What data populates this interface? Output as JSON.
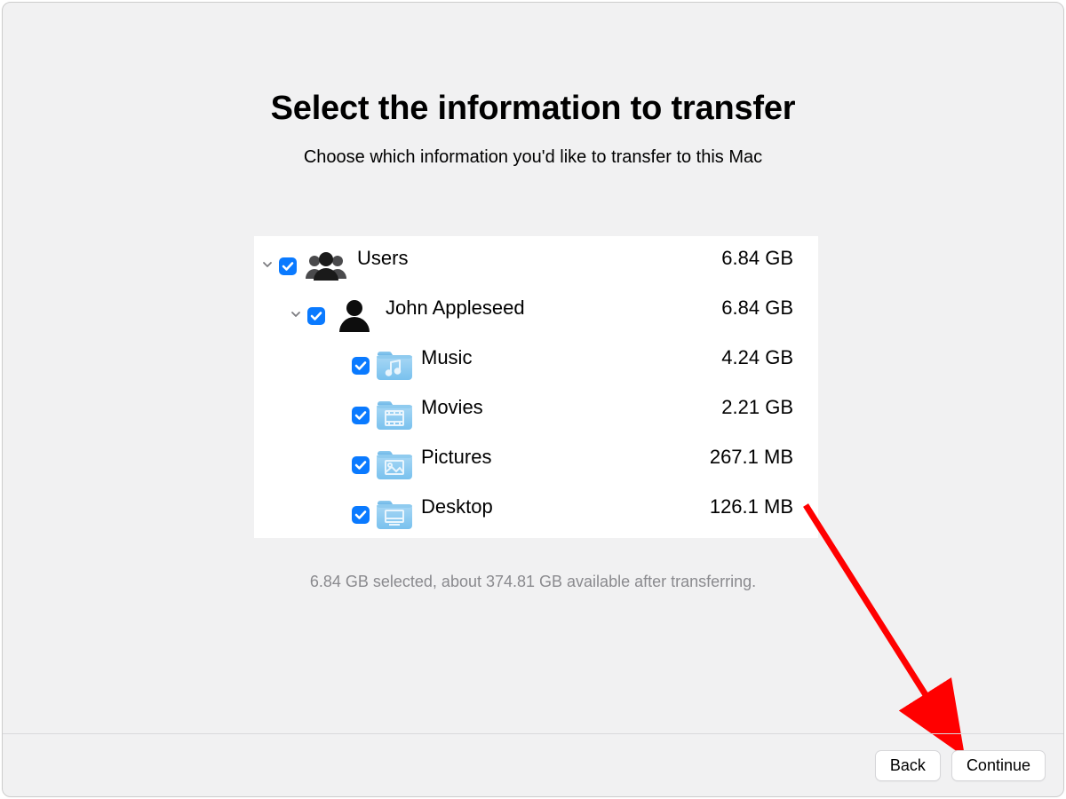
{
  "title": "Select the information to transfer",
  "subtitle": "Choose which information you'd like to transfer to this Mac",
  "tree": {
    "users": {
      "label": "Users",
      "size": "6.84 GB"
    },
    "user": {
      "label": "John Appleseed",
      "size": "6.84 GB"
    },
    "music": {
      "label": "Music",
      "size": "4.24 GB"
    },
    "movies": {
      "label": "Movies",
      "size": "2.21 GB"
    },
    "pictures": {
      "label": "Pictures",
      "size": "267.1 MB"
    },
    "desktop": {
      "label": "Desktop",
      "size": "126.1 MB"
    }
  },
  "summary": "6.84 GB selected, about 374.81 GB available after transferring.",
  "buttons": {
    "back": "Back",
    "continue": "Continue"
  }
}
